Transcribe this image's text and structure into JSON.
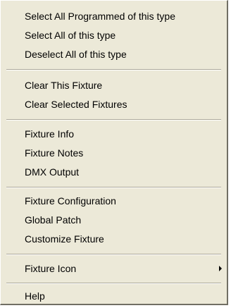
{
  "menu": {
    "items": [
      {
        "label": "Select All Programmed of this type"
      },
      {
        "label": "Select All of this type"
      },
      {
        "label": "Deselect All of this type"
      },
      {
        "label": "Clear This Fixture"
      },
      {
        "label": "Clear Selected Fixtures"
      },
      {
        "label": "Fixture Info"
      },
      {
        "label": "Fixture Notes"
      },
      {
        "label": "DMX Output"
      },
      {
        "label": "Fixture Configuration"
      },
      {
        "label": "Global Patch"
      },
      {
        "label": "Customize Fixture"
      },
      {
        "label": "Fixture Icon",
        "submenu_icon": "submenu-arrow-icon"
      },
      {
        "label": "Help"
      }
    ]
  }
}
